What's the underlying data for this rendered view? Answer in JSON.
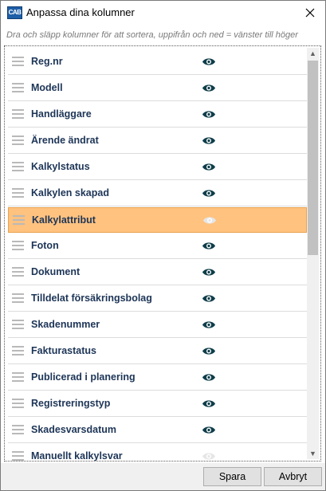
{
  "window": {
    "title": "Anpassa dina kolumner",
    "icon_text": "CAB",
    "close_icon": "close-icon"
  },
  "hint": "Dra och släpp kolumner för att sortera, uppifrån och ned = vänster till höger",
  "columns": [
    {
      "label": "Reg.nr",
      "visible": true,
      "selected": false
    },
    {
      "label": "Modell",
      "visible": true,
      "selected": false
    },
    {
      "label": "Handläggare",
      "visible": true,
      "selected": false
    },
    {
      "label": "Ärende ändrat",
      "visible": true,
      "selected": false
    },
    {
      "label": "Kalkylstatus",
      "visible": true,
      "selected": false
    },
    {
      "label": "Kalkylen skapad",
      "visible": true,
      "selected": false
    },
    {
      "label": "Kalkylattribut",
      "visible": false,
      "selected": true
    },
    {
      "label": "Foton",
      "visible": true,
      "selected": false
    },
    {
      "label": "Dokument",
      "visible": true,
      "selected": false
    },
    {
      "label": "Tilldelat försäkringsbolag",
      "visible": true,
      "selected": false
    },
    {
      "label": "Skadenummer",
      "visible": true,
      "selected": false
    },
    {
      "label": "Fakturastatus",
      "visible": true,
      "selected": false
    },
    {
      "label": "Publicerad i planering",
      "visible": true,
      "selected": false
    },
    {
      "label": "Registreringstyp",
      "visible": true,
      "selected": false
    },
    {
      "label": "Skadesvarsdatum",
      "visible": true,
      "selected": false
    },
    {
      "label": "Manuellt kalkylsvar",
      "visible": false,
      "selected": false
    }
  ],
  "buttons": {
    "save": "Spara",
    "cancel": "Avbryt"
  },
  "colors": {
    "accent_selected": "#ffc27f",
    "eye_visible": "#0f3e4a",
    "eye_hidden": "#e6e6e6",
    "label_text": "#1d3557"
  }
}
